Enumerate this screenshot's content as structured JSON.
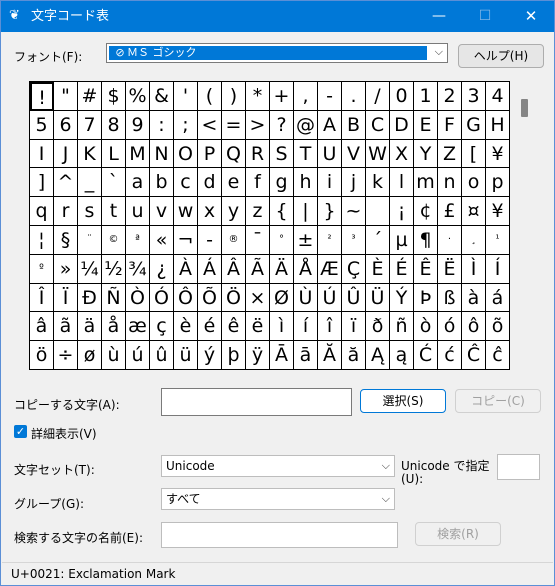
{
  "window": {
    "title": "文字コード表",
    "app_icon": "charmap-icon",
    "accent": "#0078d7"
  },
  "font_label": "フォント(F):",
  "font_selected": "ＭＳ ゴシック",
  "help_button": "ヘルプ(H)",
  "grid": {
    "rows": [
      [
        "!",
        "\"",
        "#",
        "$",
        "%",
        "&",
        "'",
        "(",
        ")",
        "*",
        "+",
        ",",
        "-",
        ".",
        "/",
        "0",
        "1",
        "2",
        "3",
        "4"
      ],
      [
        "5",
        "6",
        "7",
        "8",
        "9",
        ":",
        ";",
        "<",
        "=",
        ">",
        "?",
        "@",
        "A",
        "B",
        "C",
        "D",
        "E",
        "F",
        "G",
        "H"
      ],
      [
        "I",
        "J",
        "K",
        "L",
        "M",
        "N",
        "O",
        "P",
        "Q",
        "R",
        "S",
        "T",
        "U",
        "V",
        "W",
        "X",
        "Y",
        "Z",
        "[",
        "¥"
      ],
      [
        "]",
        "^",
        "_",
        "`",
        "a",
        "b",
        "c",
        "d",
        "e",
        "f",
        "g",
        "h",
        "i",
        "j",
        "k",
        "l",
        "m",
        "n",
        "o",
        "p"
      ],
      [
        "q",
        "r",
        "s",
        "t",
        "u",
        "v",
        "w",
        "x",
        "y",
        "z",
        "{",
        "|",
        "}",
        "~",
        " ",
        "¡",
        "¢",
        "£",
        "¤",
        "¥"
      ],
      [
        "¦",
        "§",
        "¨",
        "©",
        "ª",
        "«",
        "¬",
        "-",
        "®",
        "¯",
        "°",
        "±",
        "²",
        "³",
        "´",
        "µ",
        "¶",
        "·",
        "¸",
        "¹"
      ],
      [
        "º",
        "»",
        "¼",
        "½",
        "¾",
        "¿",
        "À",
        "Á",
        "Â",
        "Ã",
        "Ä",
        "Å",
        "Æ",
        "Ç",
        "È",
        "É",
        "Ê",
        "Ë",
        "Ì",
        "Í"
      ],
      [
        "Î",
        "Ï",
        "Ð",
        "Ñ",
        "Ò",
        "Ó",
        "Ô",
        "Õ",
        "Ö",
        "×",
        "Ø",
        "Ù",
        "Ú",
        "Û",
        "Ü",
        "Ý",
        "Þ",
        "ß",
        "à",
        "á"
      ],
      [
        "â",
        "ã",
        "ä",
        "å",
        "æ",
        "ç",
        "è",
        "é",
        "ê",
        "ë",
        "ì",
        "í",
        "î",
        "ï",
        "ð",
        "ñ",
        "ò",
        "ó",
        "ô",
        "õ"
      ],
      [
        "ö",
        "÷",
        "ø",
        "ù",
        "ú",
        "û",
        "ü",
        "ý",
        "þ",
        "ÿ",
        "Ā",
        "ā",
        "Ă",
        "ă",
        "Ą",
        "ą",
        "Ć",
        "ć",
        "Ĉ",
        "ĉ"
      ]
    ]
  },
  "copy_label": "コピーする文字(A):",
  "copy_value": "",
  "select_button": "選択(S)",
  "copy_button": "コピー(C)",
  "advanced_checkbox": {
    "label": "詳細表示(V)",
    "checked": true
  },
  "charset_label": "文字セット(T):",
  "charset_value": "Unicode",
  "unicode_label_line1": "Unicode で指定",
  "unicode_label_line2": "(U):",
  "unicode_value": "",
  "group_label": "グループ(G):",
  "group_value": "すべて",
  "search_label": "検索する文字の名前(E):",
  "search_value": "",
  "search_button": "検索(R)",
  "status": "U+0021: Exclamation Mark"
}
